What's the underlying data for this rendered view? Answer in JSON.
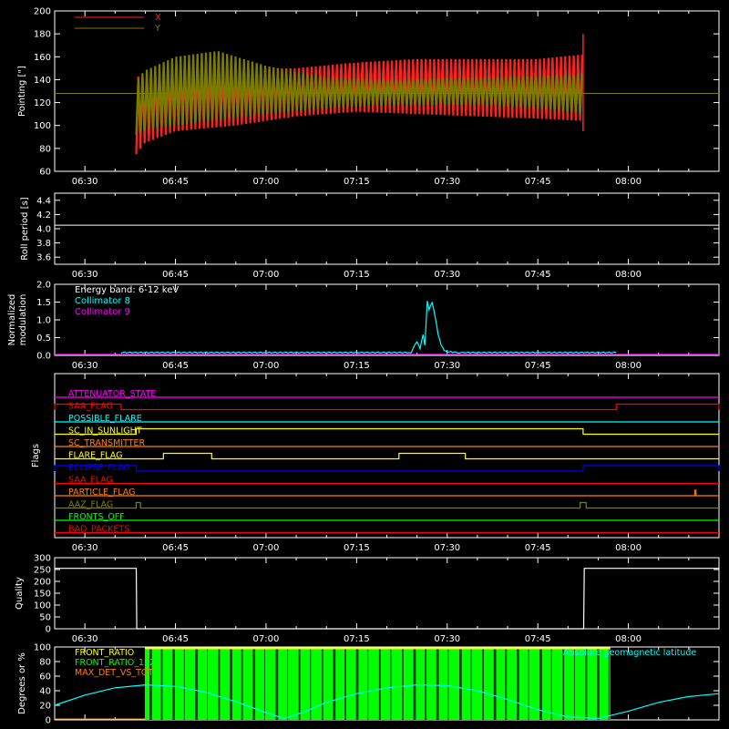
{
  "chart_data": [
    {
      "type": "line",
      "panel": "pointing",
      "ylabel": "Pointing [\"]",
      "ylim": [
        60,
        200
      ],
      "yticks": [
        60,
        80,
        100,
        120,
        140,
        160,
        180,
        200
      ],
      "xticks": [
        "06:30",
        "06:45",
        "07:00",
        "07:15",
        "07:30",
        "07:45",
        "08:00"
      ],
      "xlim_min": [
        25,
        125
      ],
      "legend_position": "top-left",
      "reference_level": 128,
      "series": [
        {
          "name": "X",
          "color": "#ff2020",
          "envelope": {
            "t": [
              38.5,
              40,
              45,
              55,
              65,
              75,
              85,
              95,
              105,
              112.5
            ],
            "low": [
              75,
              85,
              95,
              100,
              108,
              112,
              110,
              108,
              106,
              104
            ],
            "high": [
              142,
              145,
              150,
              150,
              150,
              155,
              158,
              158,
              158,
              162
            ]
          }
        },
        {
          "name": "Y",
          "color": "#7b7b00",
          "envelope": {
            "t": [
              38.5,
              40,
              45,
              52,
              60,
              70,
              80,
              95,
              105,
              112.5
            ],
            "low": [
              92,
              96,
              100,
              105,
              110,
              115,
              118,
              118,
              115,
              110
            ],
            "high": [
              140,
              148,
              160,
              165,
              152,
              142,
              140,
              142,
              143,
              145
            ]
          }
        }
      ]
    },
    {
      "type": "line",
      "panel": "roll",
      "ylabel": "Roll period [s]",
      "ylim": [
        3.5,
        4.5
      ],
      "yticks": [
        3.6,
        3.8,
        4.0,
        4.2,
        4.4
      ],
      "xticks": [
        "06:30",
        "06:45",
        "07:00",
        "07:15",
        "07:30",
        "07:45",
        "08:00"
      ],
      "series": [
        {
          "name": "",
          "color": "#ffffff",
          "level": 4.05
        }
      ]
    },
    {
      "type": "line",
      "panel": "modulation",
      "ylabel": [
        "Normalized",
        "modulation"
      ],
      "ylim": [
        0,
        2.0
      ],
      "yticks": [
        0.0,
        0.5,
        1.0,
        1.5,
        2.0
      ],
      "xticks": [
        "06:30",
        "06:45",
        "07:00",
        "07:15",
        "07:30",
        "07:45",
        "08:00"
      ],
      "annotation": "Energy band: 6-12 keV",
      "series": [
        {
          "name": "Collimator 8",
          "color": "#00ffff",
          "x": [
            36,
            60,
            84,
            85,
            85.5,
            86,
            86.3,
            86.7,
            87,
            87.5,
            88,
            88.5,
            89,
            89.5,
            90,
            92,
            100,
            118
          ],
          "y": [
            0.08,
            0.08,
            0.08,
            0.4,
            0.2,
            0.6,
            0.3,
            1.55,
            1.3,
            1.5,
            1.1,
            0.6,
            0.3,
            0.15,
            0.1,
            0.08,
            0.08,
            0.08
          ]
        },
        {
          "name": "Collimator 9",
          "color": "#ff00ff",
          "level": 0.0
        }
      ]
    },
    {
      "type": "line",
      "panel": "flags",
      "ylabel": "Flags",
      "xticks": [
        "06:30",
        "06:45",
        "07:00",
        "07:15",
        "07:30",
        "07:45",
        "08:00"
      ],
      "flags": [
        {
          "name": "ATTENUATOR_STATE",
          "color": "#ff00ff",
          "high": []
        },
        {
          "name": "SAA_FLAG_RAW",
          "label": "SAA_FLAG",
          "color": "#ff0000",
          "high": [
            [
              25,
              36
            ],
            [
              118,
              135
            ]
          ]
        },
        {
          "name": "POSSIBLE_FLARE",
          "color": "#00ffff",
          "high": []
        },
        {
          "name": "SC_IN_SUNLIGHT",
          "color": "#ffff00",
          "high": [
            [
              38.5,
              112.5
            ]
          ]
        },
        {
          "name": "SC_TRANSMITTER",
          "color": "#ff7f00",
          "high": []
        },
        {
          "name": "FLARE_FLAG",
          "color": "#ffff00",
          "high": [
            [
              43,
              51
            ],
            [
              82,
              93
            ]
          ]
        },
        {
          "name": "ECLIPSE_FLAG",
          "color": "#0000ff",
          "high": [
            [
              25,
              38.5
            ],
            [
              112.5,
              135
            ]
          ]
        },
        {
          "name": "SAA_FLAG",
          "color": "#ff0000",
          "high": []
        },
        {
          "name": "PARTICLE_FLAG",
          "color": "#ff7f00",
          "high": [
            [
              131,
              131.2
            ]
          ]
        },
        {
          "name": "AAZ_FLAG",
          "color": "#808000",
          "high": [
            [
              38.5,
              39.2
            ],
            [
              112,
              113
            ]
          ]
        },
        {
          "name": "FRONTS_OFF",
          "color": "#00ff00",
          "high": []
        },
        {
          "name": "BAD_PACKETS",
          "color": "#ff0000",
          "high": []
        }
      ]
    },
    {
      "type": "line",
      "panel": "quality",
      "ylabel": "Quality",
      "ylim": [
        0,
        300
      ],
      "yticks": [
        0,
        50,
        100,
        150,
        200,
        250,
        300
      ],
      "xticks": [
        "06:30",
        "06:45",
        "07:00",
        "07:15",
        "07:30",
        "07:45",
        "08:00"
      ],
      "series": [
        {
          "name": "",
          "color": "#ffffff",
          "x": [
            25,
            38.5,
            38.6,
            112.6,
            112.7,
            135
          ],
          "y": [
            255,
            255,
            0,
            0,
            255,
            255
          ]
        }
      ]
    },
    {
      "type": "line",
      "panel": "ratios",
      "ylabel": "Degrees or %",
      "ylim": [
        0,
        100
      ],
      "yticks": [
        0,
        20,
        40,
        60,
        80,
        100
      ],
      "xticks": [
        "06:30",
        "06:45",
        "07:00",
        "07:15",
        "07:30",
        "07:45",
        "08:00"
      ],
      "legend": [
        "FRONT_RATIO",
        "FRONT_RATIO_1225",
        "MAX_DET_VS_TOT"
      ],
      "legend_colors": [
        "#ffff00",
        "#00ff00",
        "#ff7f00"
      ],
      "right_legend": "Absolute geomagnetic latitude",
      "green_band": [
        40,
        117
      ],
      "series": [
        {
          "name": "Absolute geomagnetic latitude",
          "color": "#00ffff",
          "x": [
            25,
            30,
            35,
            40,
            45,
            50,
            55,
            60,
            63,
            66,
            70,
            75,
            80,
            85,
            90,
            95,
            100,
            105,
            110,
            115,
            120,
            125,
            130,
            135
          ],
          "y": [
            20,
            34,
            44,
            48,
            46,
            38,
            25,
            10,
            2,
            10,
            24,
            36,
            44,
            48,
            47,
            40,
            28,
            14,
            4,
            2,
            12,
            24,
            32,
            36
          ]
        }
      ]
    }
  ]
}
